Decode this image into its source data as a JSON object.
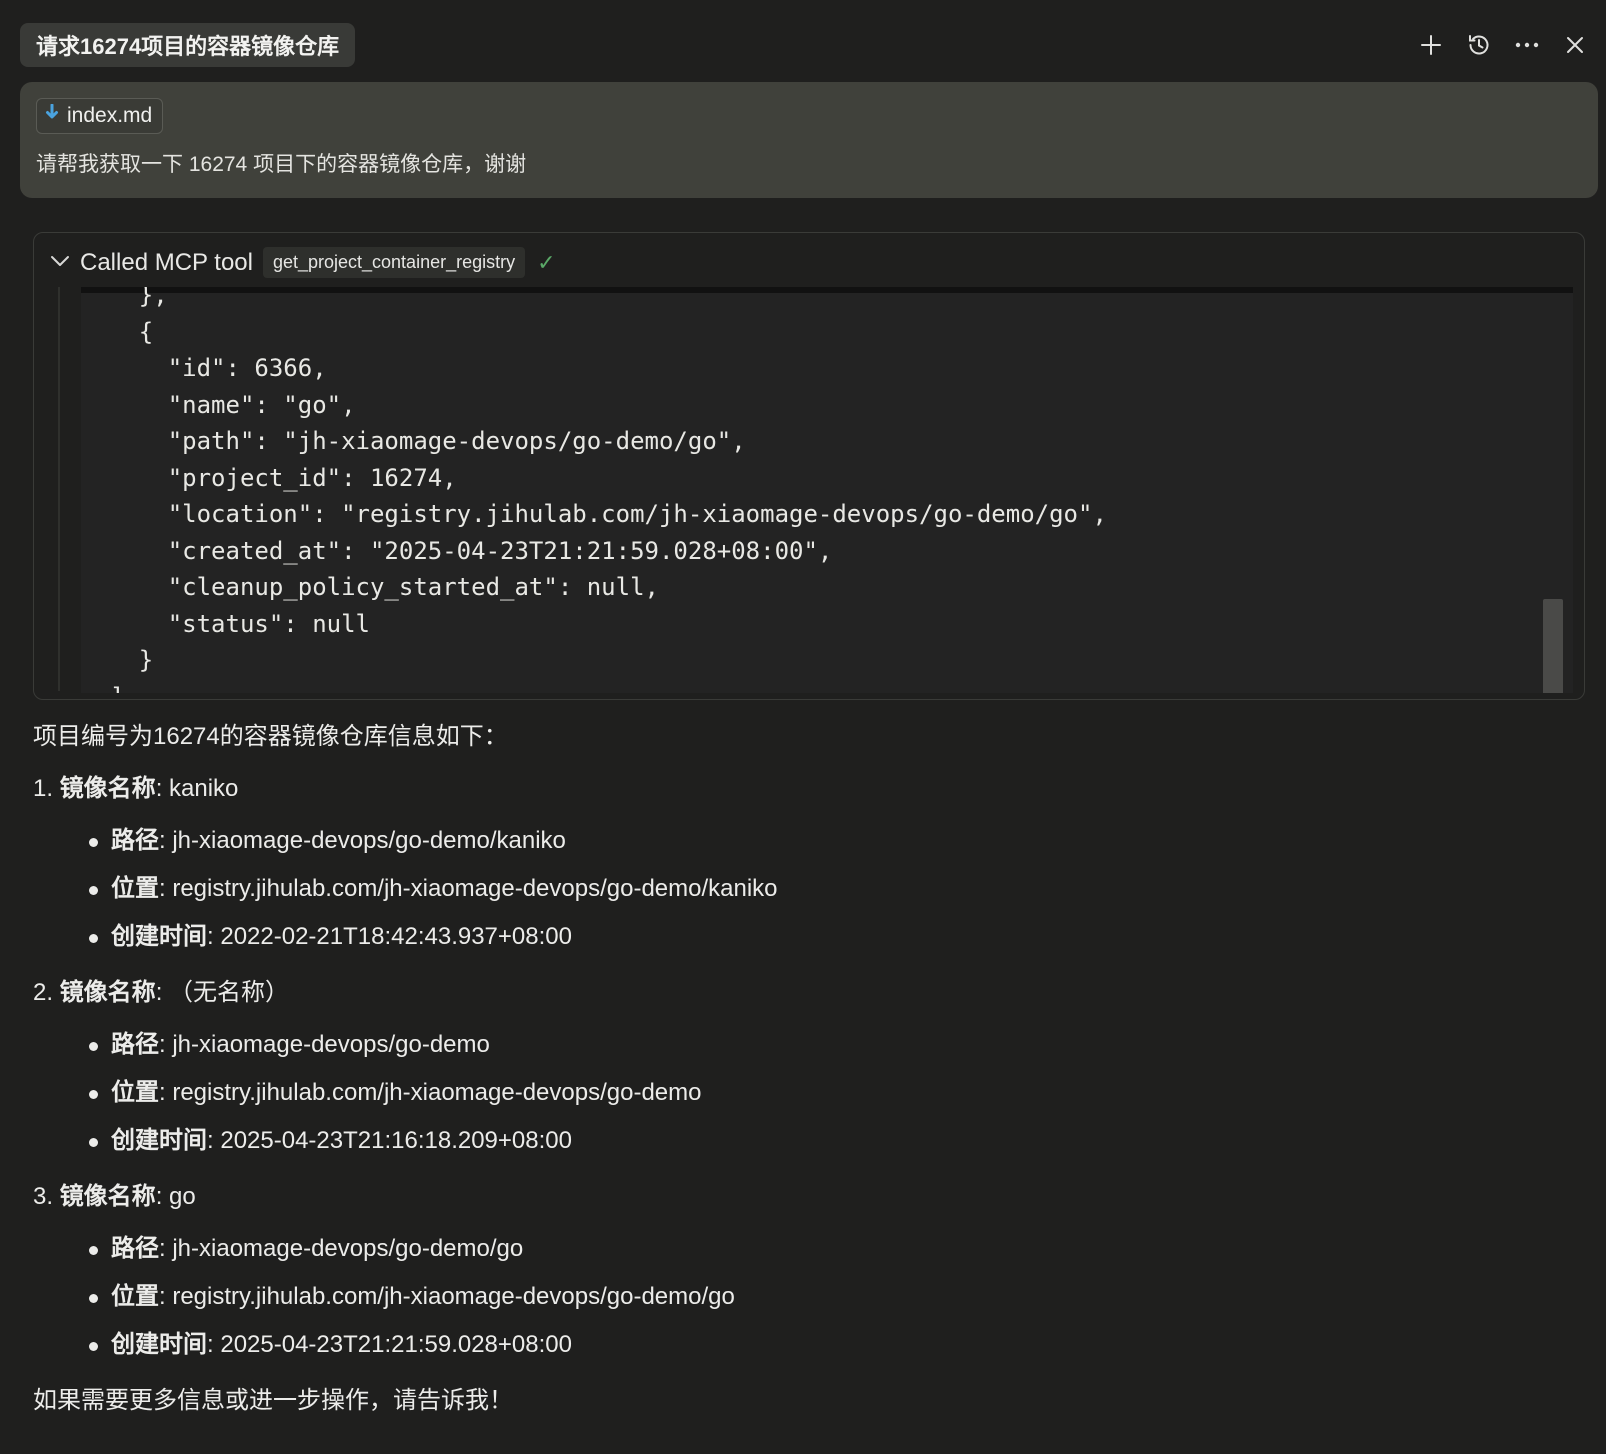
{
  "header": {
    "title": "请求16274项目的容器镜像仓库",
    "actions": [
      {
        "name": "new-chat-icon",
        "label": "+"
      },
      {
        "name": "history-icon"
      },
      {
        "name": "more-icon"
      },
      {
        "name": "close-icon"
      }
    ]
  },
  "user_message": {
    "file_name": "index.md",
    "text": "请帮我获取一下 16274 项目下的容器镜像仓库，谢谢"
  },
  "tool_call": {
    "label": "Called MCP tool",
    "tool_name": "get_project_container_registry",
    "status": "✓",
    "output_lines": [
      "    },",
      "    {",
      "      \"id\": 6366,",
      "      \"name\": \"go\",",
      "      \"path\": \"jh-xiaomage-devops/go-demo/go\",",
      "      \"project_id\": 16274,",
      "      \"location\": \"registry.jihulab.com/jh-xiaomage-devops/go-demo/go\",",
      "      \"created_at\": \"2025-04-23T21:21:59.028+08:00\",",
      "      \"cleanup_policy_started_at\": null,",
      "      \"status\": null",
      "    }",
      "  ]"
    ]
  },
  "answer": {
    "intro": "项目编号为16274的容器镜像仓库信息如下：",
    "name_label": "镜像名称",
    "path_label": "路径",
    "location_label": "位置",
    "created_label": "创建时间",
    "items": [
      {
        "index": "1.",
        "name": "kaniko",
        "path": "jh-xiaomage-devops/go-demo/kaniko",
        "location": "registry.jihulab.com/jh-xiaomage-devops/go-demo/kaniko",
        "created_at": "2022-02-21T18:42:43.937+08:00"
      },
      {
        "index": "2.",
        "name": "（无名称）",
        "path": "jh-xiaomage-devops/go-demo",
        "location": "registry.jihulab.com/jh-xiaomage-devops/go-demo",
        "created_at": "2025-04-23T21:16:18.209+08:00"
      },
      {
        "index": "3.",
        "name": "go",
        "path": "jh-xiaomage-devops/go-demo/go",
        "location": "registry.jihulab.com/jh-xiaomage-devops/go-demo/go",
        "created_at": "2025-04-23T21:21:59.028+08:00"
      }
    ],
    "outro": "如果需要更多信息或进一步操作，请告诉我！"
  }
}
